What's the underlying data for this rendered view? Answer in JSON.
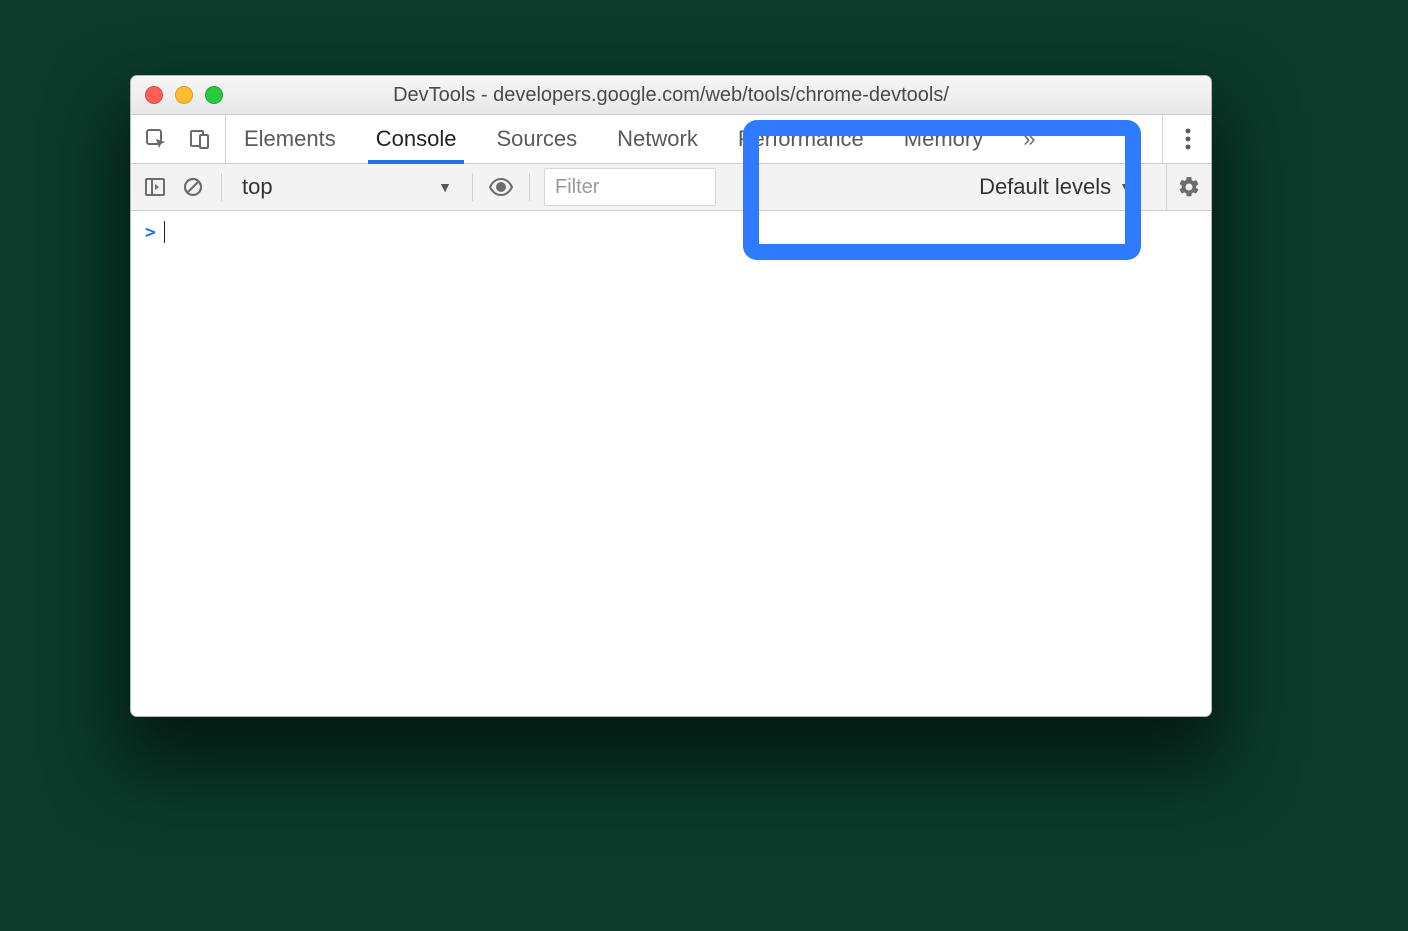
{
  "window": {
    "title": "DevTools - developers.google.com/web/tools/chrome-devtools/"
  },
  "tabs": {
    "items": [
      {
        "label": "Elements"
      },
      {
        "label": "Console"
      },
      {
        "label": "Sources"
      },
      {
        "label": "Network"
      },
      {
        "label": "Performance"
      },
      {
        "label": "Memory"
      }
    ],
    "active_index": 1
  },
  "console_toolbar": {
    "context": "top",
    "filter_placeholder": "Filter",
    "levels_label": "Default levels"
  },
  "console": {
    "prompt_symbol": ">"
  }
}
